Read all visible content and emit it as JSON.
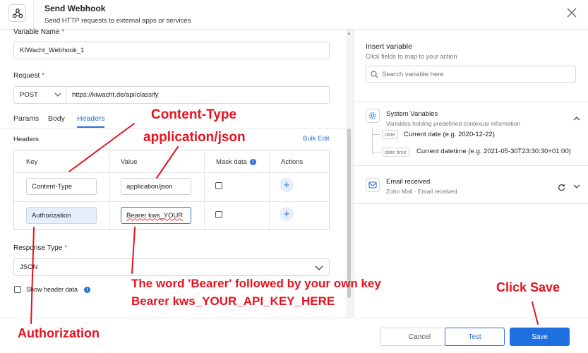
{
  "header": {
    "title": "Send Webhook",
    "subtitle": "Send HTTP requests to external apps or services"
  },
  "form": {
    "variable_name_label": "Variable Name",
    "required_mark": "*",
    "variable_name_value": "KIWacht_Webhook_1",
    "request_label": "Request",
    "method": "POST",
    "url": "https://kiwacht.de/api/classify",
    "tabs": [
      {
        "label": "Params"
      },
      {
        "label": "Body"
      },
      {
        "label": "Headers"
      }
    ],
    "headers_label": "Headers",
    "bulk_edit": "Bulk Edit",
    "columns": {
      "key": "Key",
      "value": "Value",
      "mask": "Mask data",
      "actions": "Actions"
    },
    "rows": [
      {
        "key": "Content-Type",
        "value": "application/json",
        "mask": false
      },
      {
        "key": "Authorization",
        "value": "Bearer kws_YOUR",
        "mask": false
      }
    ],
    "response_type_label": "Response Type",
    "response_type_value": "JSON",
    "show_header_data": "Show header data"
  },
  "sidebar": {
    "insert_variable_title": "Insert variable",
    "insert_variable_hint": "Click fields to map to your action",
    "search_placeholder": "Search variable here",
    "system_variables": {
      "title": "System Variables",
      "subtitle": "Variables holding predefined contexual information",
      "items": [
        {
          "badge": "date",
          "label": "Current date (e.g. 2020-12-22)"
        },
        {
          "badge": "date time",
          "label": "Current datetime (e.g. 2021-05-30T23:30:30+01:00)"
        }
      ]
    },
    "email": {
      "title": "Email received",
      "subtitle": "Zoho Mail · Email received"
    }
  },
  "footer": {
    "cancel": "Cancel",
    "test": "Test",
    "save": "Save"
  },
  "annotations": {
    "content_type": "Content-Type",
    "application_json": "application/json",
    "bearer_line1": "The word 'Bearer' followed by your own key",
    "bearer_line2": "Bearer kws_YOUR_API_KEY_HERE",
    "authorization": "Authorization",
    "click_save": "Click Save"
  },
  "colors": {
    "accent": "#2a6fd6",
    "annotation": "#e8121f",
    "required": "#e53935"
  }
}
